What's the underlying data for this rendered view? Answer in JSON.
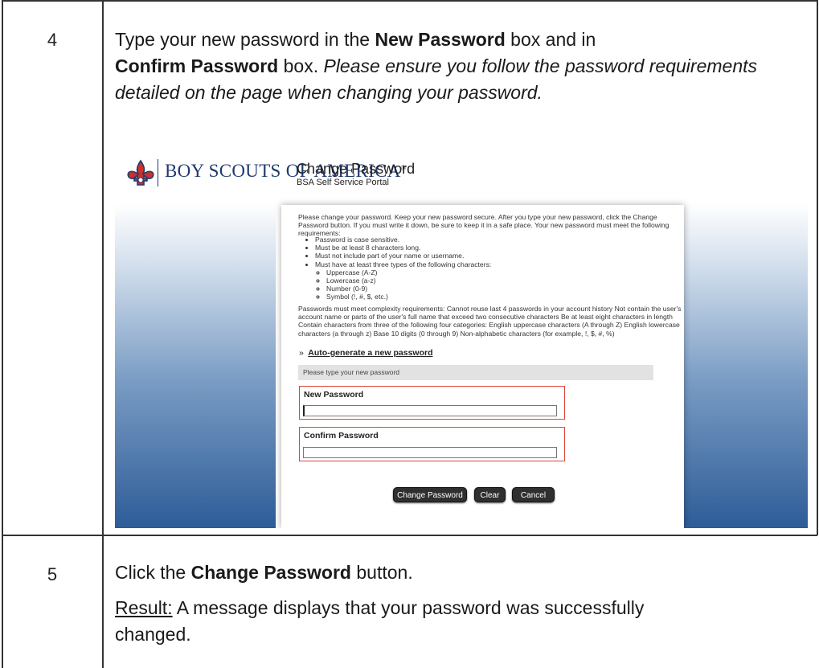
{
  "steps": [
    {
      "number": "4",
      "text_parts": {
        "a": "Type your new password in the ",
        "b": "New Password",
        "c": " box and in ",
        "d": "Confirm Password",
        "e": " box. ",
        "f": "Please ensure you follow the password requirements detailed on the page when changing your password."
      }
    },
    {
      "number": "5",
      "text_parts": {
        "a": "Click the ",
        "b": "Change Password",
        "c": " button."
      },
      "result_label": "Result:",
      "result_text": "  A message displays that your password was successfully changed."
    }
  ],
  "screenshot": {
    "brand": "BOY SCOUTS OF AMERICA",
    "brand_mark": "®",
    "logo_icon": "fleur-de-lis-icon",
    "title": "Change Password",
    "subtitle": "BSA Self Service Portal",
    "intro": "Please change your password. Keep your new password secure. After you type your new password, click the Change Password button. If you must write it down, be sure to keep it in a safe place. Your new password must meet the following requirements:",
    "requirements": [
      "Password is case sensitive.",
      "Must be at least 8 characters long.",
      "Must not include part of your name or username.",
      "Must have at least three types of the following characters:"
    ],
    "char_types": [
      "Uppercase (A-Z)",
      "Lowercase (a-z)",
      "Number (0-9)",
      "Symbol (!, #, $, etc.)"
    ],
    "complexity": "Passwords must meet complexity requirements: Cannot reuse last 4 passwords in your account history Not contain the user's account name or parts of the user's full name that exceed two consecutive characters Be at least eight characters in length Contain characters from three of the following four categories: English uppercase characters (A through Z) English lowercase characters (a through z) Base 10 digits (0 through 9) Non-alphabetic characters (for example, !, $, #, %)",
    "autogen_bullet": "»",
    "autogen_link": "Auto-generate a new password",
    "hint": "Please type your new password",
    "new_password_label": "New Password",
    "new_password_value": "",
    "confirm_password_label": "Confirm Password",
    "confirm_password_value": "",
    "buttons": {
      "change": "Change Password",
      "clear": "Clear",
      "cancel": "Cancel"
    },
    "colors": {
      "brand_blue": "#1f3a6e",
      "gradient_blue": "#2d5c97",
      "field_border_red": "#d9443b",
      "button_dark": "#2f2f2f"
    }
  }
}
